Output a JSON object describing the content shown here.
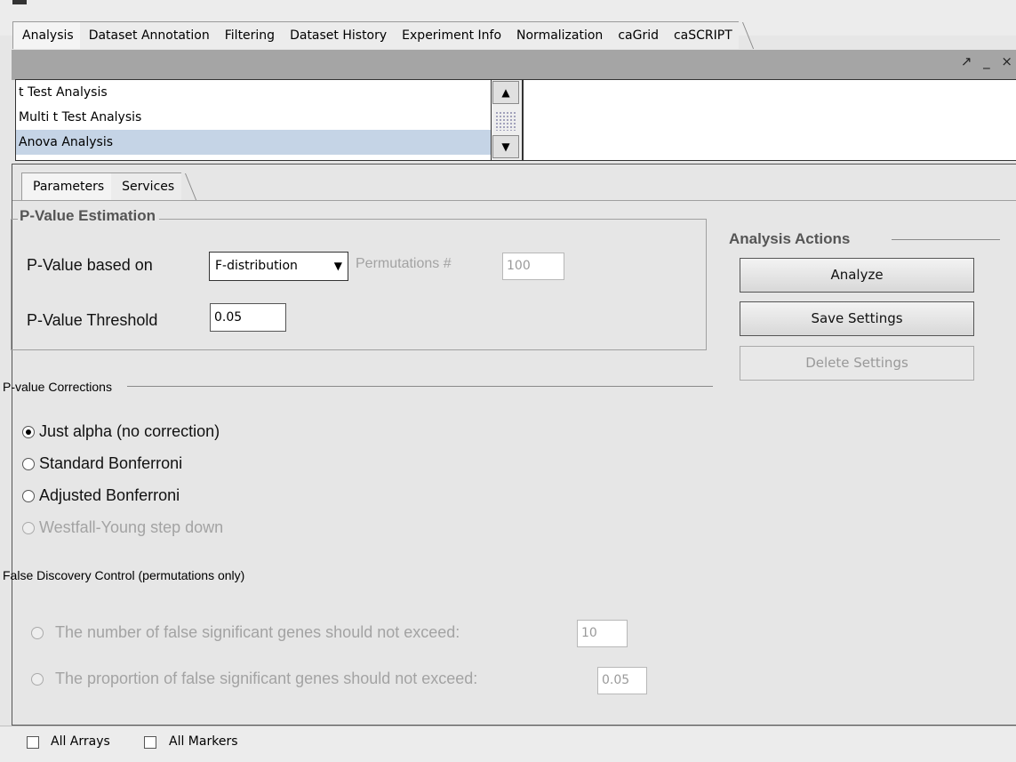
{
  "top_tabs": [
    "Analysis",
    "Dataset Annotation",
    "Filtering",
    "Dataset History",
    "Experiment Info",
    "Normalization",
    "caGrid",
    "caSCRIPT"
  ],
  "window_controls": "↗ _ ×",
  "analysis_list": {
    "items": [
      "t Test Analysis",
      "Multi t Test Analysis",
      "Anova Analysis"
    ],
    "selected": "Anova Analysis"
  },
  "inner_tabs": [
    "Parameters",
    "Services"
  ],
  "pvalue_estimation": {
    "title": "P-Value Estimation",
    "based_on_label": "P-Value based on",
    "based_on_value": "F-distribution",
    "permutations_label": "Permutations #",
    "permutations_value": "100",
    "threshold_label": "P-Value Threshold",
    "threshold_value": "0.05"
  },
  "corrections": {
    "title": "P-value Corrections",
    "options": [
      "Just alpha (no correction)",
      "Standard Bonferroni",
      "Adjusted Bonferroni",
      "Westfall-Young step down"
    ],
    "selected": "Just alpha (no correction)"
  },
  "fdc": {
    "title": "False Discovery Control (permutations only)",
    "number_label": "The number of false significant genes should not exceed:",
    "number_value": "10",
    "proportion_label": "The proportion of false significant genes should not exceed:",
    "proportion_value": "0.05"
  },
  "actions": {
    "title": "Analysis Actions",
    "analyze": "Analyze",
    "save": "Save Settings",
    "delete": "Delete Settings"
  },
  "bottom": {
    "all_arrays": "All Arrays",
    "all_markers": "All Markers"
  }
}
